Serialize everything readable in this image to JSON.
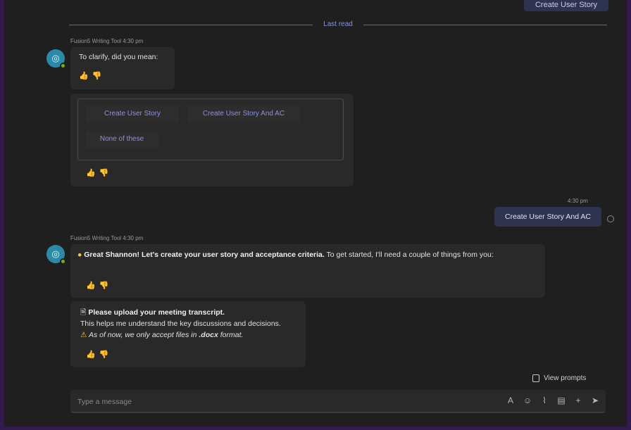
{
  "top_chip": {
    "label": "Create User Story"
  },
  "divider": {
    "label": "Last read"
  },
  "message1": {
    "sender": "Fusion5 Writing Tool",
    "time": "4:30 pm",
    "text": "To clarify, did you mean:"
  },
  "suggestions": {
    "options": [
      "Create User Story",
      "Create User Story And AC",
      "None of these"
    ]
  },
  "user_message": {
    "time": "4:30 pm",
    "text": "Create User Story And AC"
  },
  "message2": {
    "sender": "Fusion5 Writing Tool",
    "time": "4:30 pm",
    "bold": "Great Shannon! Let's create your user story and acceptance criteria.",
    "rest": "To get started, I'll need a couple of things from you:"
  },
  "message3": {
    "heading": "Please upload your meeting transcript.",
    "line": "This helps me understand the key discussions and decisions.",
    "warning_prefix": "As of now, we only accept files in",
    "warning_format": ".docx",
    "warning_suffix": "format."
  },
  "view_prompts": {
    "label": "View prompts"
  },
  "compose": {
    "placeholder": "Type a message"
  },
  "icons": {
    "avatar": "bot-avatar-icon",
    "reactions": [
      "thumbs-up-icon",
      "thumbs-down-icon"
    ],
    "toolbar": [
      "format-icon",
      "emoji-icon",
      "attach-icon",
      "loop-icon",
      "add-icon",
      "send-icon"
    ]
  },
  "colors": {
    "accent": "#5b5fc7",
    "user_bubble": "#2e3350",
    "bot_bubble": "#292929",
    "outer_frame": "#331a4d"
  }
}
